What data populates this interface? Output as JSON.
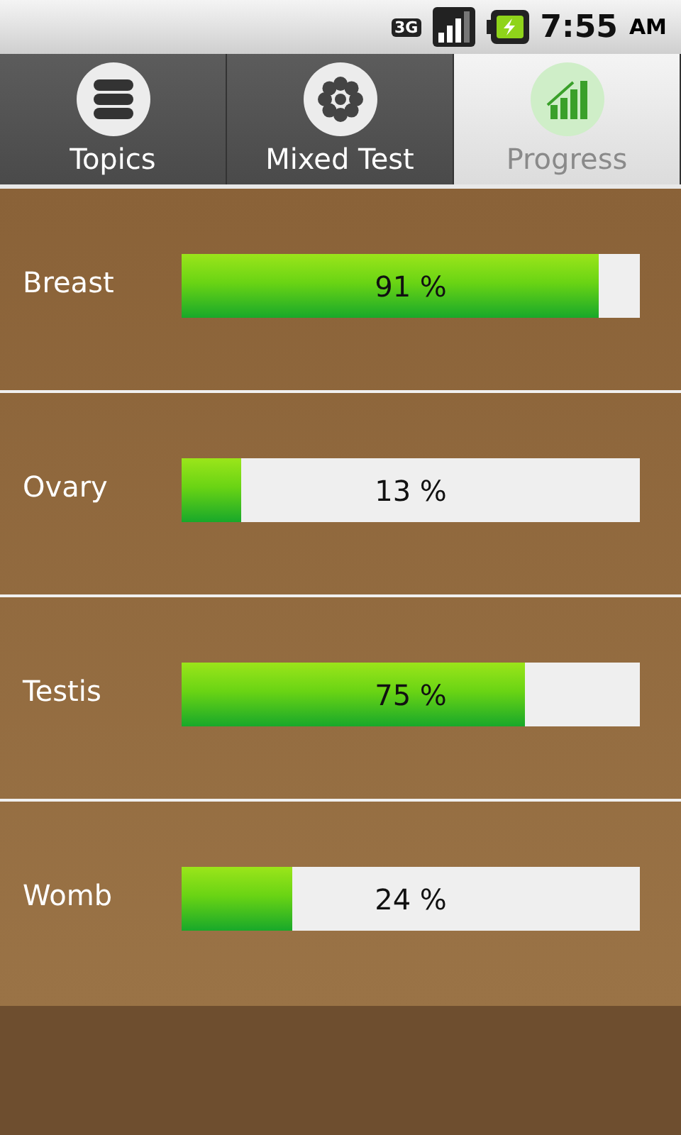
{
  "status_bar": {
    "network": "3G",
    "time": "7:55",
    "ampm": "AM"
  },
  "tabs": [
    {
      "label": "Topics",
      "selected": false
    },
    {
      "label": "Mixed Test",
      "selected": false
    },
    {
      "label": "Progress",
      "selected": true
    }
  ],
  "topics": [
    {
      "name": "Breast",
      "level": 0.91,
      "reading": "91 %"
    },
    {
      "name": "Ovary",
      "level": 0.13,
      "reading": "13 %"
    },
    {
      "name": "Testis",
      "level": 0.75,
      "reading": "75 %"
    },
    {
      "name": "Womb",
      "level": 0.24,
      "reading": "24 %"
    }
  ]
}
